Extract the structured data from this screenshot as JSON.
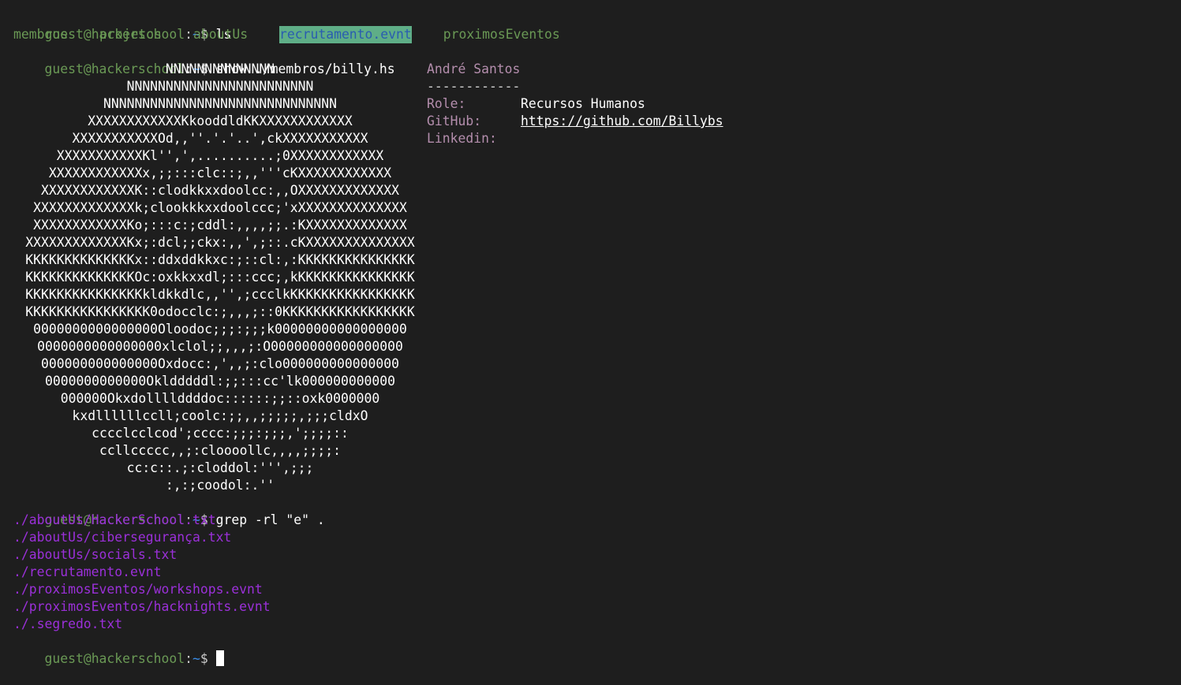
{
  "prompt": {
    "user_host": "guest@hackerschool",
    "colon": ":",
    "path": "~",
    "dollar": "$"
  },
  "commands": {
    "ls": "ls",
    "show": "show ./membros/billy.hs",
    "grep": "grep -rl \"e\" ."
  },
  "ls_output": [
    "membros",
    "projetos",
    "aboutUs",
    "recrutamento.evnt",
    "proximosEventos"
  ],
  "ascii_art": [
    "NNNNNNNNNNNNNN",
    "NNNNNNNNNNNNNNNNNNNNNNNN",
    "NNNNNNNNNNNNNNNNNNNNNNNNNNNNNN",
    "XXXXXXXXXXXXKkooddldKKXXXXXXXXXXXX",
    "XXXXXXXXXXXOd,,''.'.'..',ckXXXXXXXXXXX",
    "XXXXXXXXXXXKl'',',..........;0XXXXXXXXXXXX",
    "XXXXXXXXXXXXx,;;:::clc::;,,'''cKXXXXXXXXXXXX",
    "XXXXXXXXXXXXK::clodkkxxdoolcc:,,OXXXXXXXXXXXXX",
    "XXXXXXXXXXXXXk;clookkkxxdoolccc;'xXXXXXXXXXXXXXX",
    "XXXXXXXXXXXXKo;:::c:;cddl:,,,,;;.:KXXXXXXXXXXXXX",
    "XXXXXXXXXXXXXKx;:dcl;;ckx:,,',;::.cKXXXXXXXXXXXXXX",
    "KKKKKKKKKKKKKKx::ddxddkkxc:;::cl:,:KKKKKKKKKKKKKKK",
    "KKKKKKKKKKKKKKOc:oxkkxxdl;:::ccc;,kKKKKKKKKKKKKKKK",
    "KKKKKKKKKKKKKKKkldkkdlc,,'',;ccclkKKKKKKKKKKKKKKKK",
    "KKKKKKKKKKKKKKKK0odocclc:;,,,;::0KKKKKKKKKKKKKKKKK",
    "0000000000000000Oloodoc;;;:;;;k00000000000000000",
    "0000000000000000xlclol;;,,,;:O00000000000000000",
    "000000000000000Oxdocc:,',,;:clo000000000000000",
    "0000000000000Okldddddl:;;:::cc'lk000000000000",
    "000000Okxdollllddddoc::::::;;::oxk0000000",
    "kxdllllllccll;coolc:;;,,;;;;;,;;;cldxO",
    "cccclcclcod';cccc:;;;:;;;,';;;;::",
    "ccllccccc,,;:cloooollc,,,,;;;;:",
    "cc:c::.;:cloddol:''',;;;",
    ":,:;coodol:.''"
  ],
  "member": {
    "name": "André Santos",
    "separator": "------------",
    "role_key": "Role:",
    "role_val": "Recursos Humanos",
    "github_key": "GitHub:",
    "github_val": "https://github.com/Billybs",
    "linkedin_key": "Linkedin:",
    "linkedin_val": ""
  },
  "grep_output": [
    "./aboutUs/HackerSchool.txt",
    "./aboutUs/cibersegurança.txt",
    "./aboutUs/socials.txt",
    "./recrutamento.evnt",
    "./proximosEventos/workshops.evnt",
    "./proximosEventos/hacknights.evnt",
    "./.segredo.txt"
  ],
  "colors": {
    "background": "#1e1e1e",
    "prompt_green": "#6a9955",
    "path_blue": "#3b8eea",
    "grep_purple": "#9b30d9",
    "info_pink": "#b48ead",
    "highlight_bg": "#5fae87"
  }
}
